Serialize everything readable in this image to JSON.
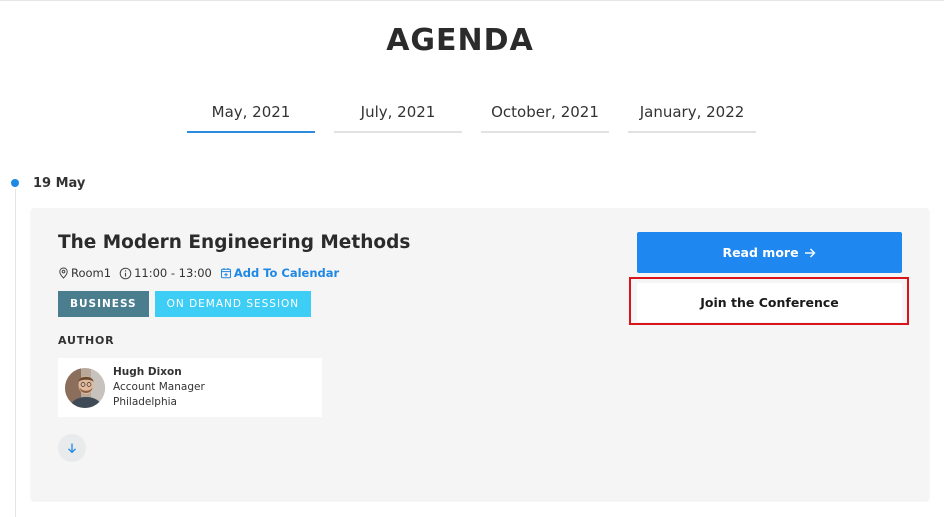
{
  "page_title": "AGENDA",
  "tabs": [
    {
      "label": "May, 2021",
      "active": true
    },
    {
      "label": "July, 2021",
      "active": false
    },
    {
      "label": "October, 2021",
      "active": false
    },
    {
      "label": "January, 2022",
      "active": false
    }
  ],
  "timeline": {
    "date": "19 May"
  },
  "session": {
    "title": "The Modern Engineering Methods",
    "room": "Room1",
    "time": "11:00 - 13:00",
    "add_to_calendar": "Add To Calendar",
    "tags": [
      "BUSINESS",
      "ON DEMAND SESSION"
    ],
    "author_heading": "AUTHOR",
    "author": {
      "name": "Hugh Dixon",
      "role": "Account Manager",
      "location": "Philadelphia"
    },
    "read_more": "Read more",
    "join": "Join the Conference"
  },
  "colors": {
    "accent": "#1e88f0",
    "business_tag": "#4a7d8e",
    "on_demand_tag": "#3ecdf5",
    "highlight_outline": "#d9141b"
  }
}
